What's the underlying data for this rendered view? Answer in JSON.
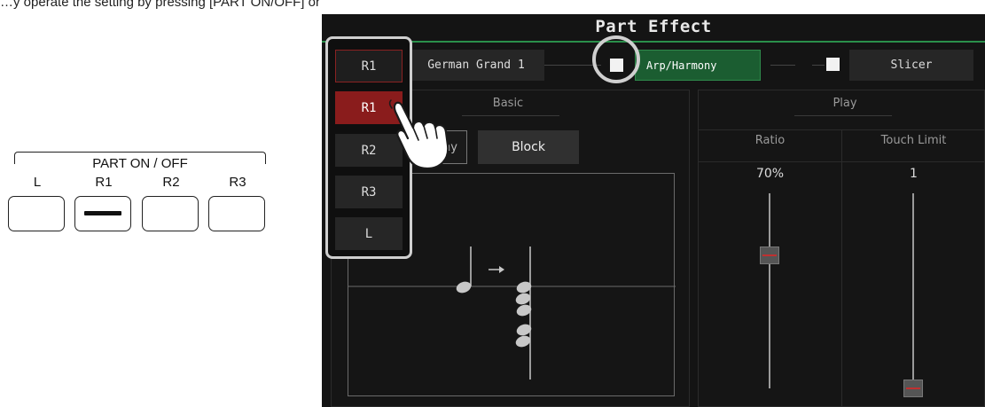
{
  "intro_text": "…y operate the setting by pressing [PART ON/OFF] or tap the corresponding part on the screen.",
  "physical_panel": {
    "title": "PART ON / OFF",
    "buttons": [
      {
        "label": "L",
        "on": false
      },
      {
        "label": "R1",
        "on": true
      },
      {
        "label": "R2",
        "on": false
      },
      {
        "label": "R3",
        "on": false
      }
    ]
  },
  "screen": {
    "title": "Part Effect",
    "part_select": "R1",
    "voice_name": "German Grand 1",
    "arp_harmony_label": "Arp/Harmony",
    "arp_harmony_checked": true,
    "slicer_label": "Slicer",
    "slicer_checked": true,
    "basic": {
      "heading": "Basic",
      "harmony_label": "Harmony",
      "block_label": "Block"
    },
    "play": {
      "heading": "Play",
      "ratio": {
        "label": "Ratio",
        "value": "70%",
        "level": 0.7
      },
      "touch_limit": {
        "label": "Touch Limit",
        "value": "1",
        "level": 0.0
      }
    },
    "part_menu": [
      "R1",
      "R1",
      "R2",
      "R3",
      "L"
    ],
    "part_menu_selected_index": 1
  },
  "colors": {
    "accent_green": "#1b5d31",
    "selected_red": "#8a1c1c",
    "screen_bg": "#141414"
  },
  "icons": [
    "hand-pointer-icon",
    "checkbox-icon",
    "quarter-note-icon",
    "arrow-right-icon",
    "chord-notes-icon"
  ]
}
